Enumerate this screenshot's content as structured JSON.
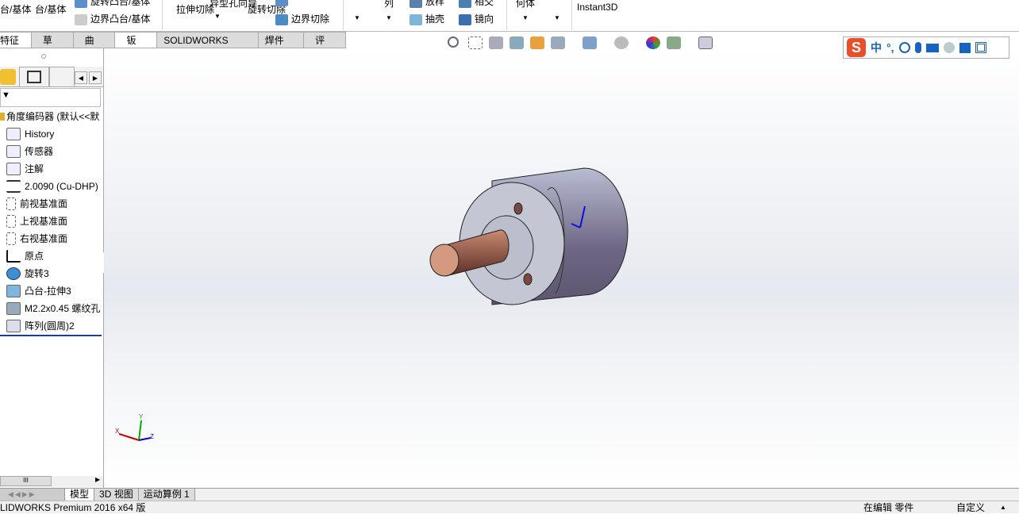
{
  "ribbon": {
    "items": [
      "台/基体",
      "台/基体",
      "旋转凸台/基体",
      "边界凸台/基体",
      "拉伸切除",
      "异型孔向导",
      "旋转切除",
      "旋转切除",
      "边界切除",
      "列",
      "放样",
      "抽壳",
      "相交",
      "镜向",
      "何体",
      "Instant3D"
    ]
  },
  "tabs": [
    {
      "label": "特征",
      "active": false
    },
    {
      "label": "草图"
    },
    {
      "label": "曲面"
    },
    {
      "label": "钣金",
      "active": true
    },
    {
      "label": "SOLIDWORKS MBD"
    },
    {
      "label": "焊件(D)"
    },
    {
      "label": "评估"
    }
  ],
  "tree": {
    "root": "角度编码器 (默认<<默",
    "items": [
      "History",
      "传感器",
      "注解",
      "2.0090 (Cu-DHP)",
      "前视基准面",
      "上视基准面",
      "右视基准面",
      "原点",
      "旋转3",
      "凸台-拉伸3",
      "M2.2x0.45 螺纹孔",
      "阵列(圆周)2"
    ]
  },
  "ime": {
    "logo": "S",
    "items": [
      "中",
      "°,"
    ]
  },
  "triad": {
    "x": "X",
    "y": "Y",
    "z": "Z"
  },
  "bottom_tabs": [
    "模型",
    "3D 视图",
    "运动算例 1"
  ],
  "status": {
    "left": "LIDWORKS Premium 2016 x64 版",
    "mode": "在编辑 零件",
    "custom": "自定义"
  },
  "colors": {
    "shaft": "#b8705a",
    "body": "#a8aac0",
    "accent": "#1565c0"
  }
}
